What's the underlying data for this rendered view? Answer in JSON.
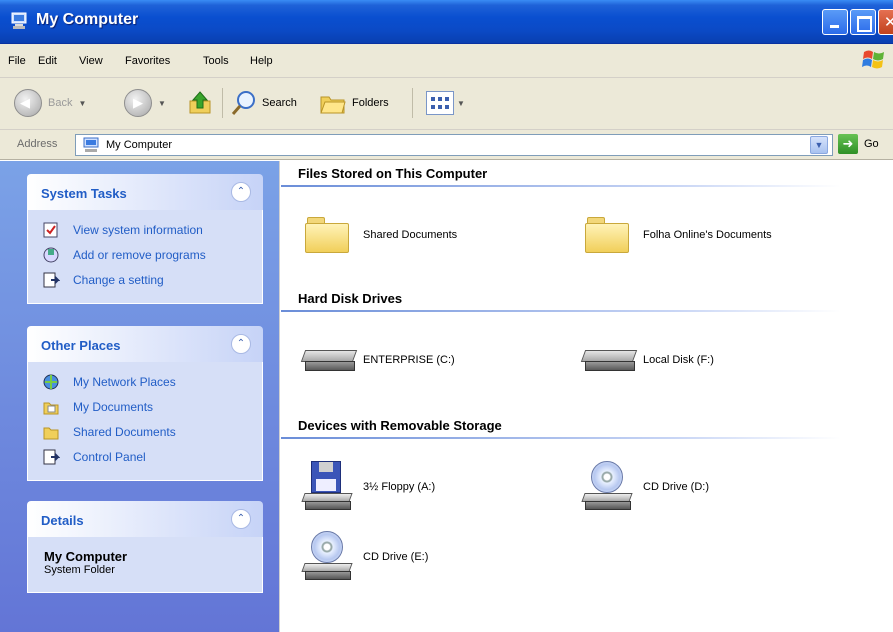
{
  "window": {
    "title": "My Computer"
  },
  "menu": [
    "File",
    "Edit",
    "View",
    "Favorites",
    "Tools",
    "Help"
  ],
  "toolbar": {
    "back_label": "Back",
    "search_label": "Search",
    "folders_label": "Folders"
  },
  "address": {
    "label": "Address",
    "value": "My Computer",
    "go_label": "Go"
  },
  "sidebar": {
    "system_tasks": {
      "title": "System Tasks",
      "items": [
        {
          "label": "View system information",
          "icon": "system-info-icon"
        },
        {
          "label": "Add or remove programs",
          "icon": "add-remove-programs-icon"
        },
        {
          "label": "Change a setting",
          "icon": "control-panel-icon"
        }
      ]
    },
    "other_places": {
      "title": "Other Places",
      "items": [
        {
          "label": "My Network Places",
          "icon": "network-places-icon"
        },
        {
          "label": "My Documents",
          "icon": "my-documents-icon"
        },
        {
          "label": "Shared Documents",
          "icon": "folder-icon"
        },
        {
          "label": "Control Panel",
          "icon": "control-panel-icon"
        }
      ]
    },
    "details": {
      "title": "Details",
      "name": "My Computer",
      "type": "System Folder"
    }
  },
  "content": {
    "groups": [
      {
        "title": "Files Stored on This Computer",
        "items": [
          {
            "label": "Shared Documents",
            "icon": "folder-icon"
          },
          {
            "label": "Folha Online's Documents",
            "icon": "folder-icon"
          }
        ]
      },
      {
        "title": "Hard Disk Drives",
        "items": [
          {
            "label": "ENTERPRISE (C:)",
            "icon": "hard-disk-icon"
          },
          {
            "label": "Local Disk (F:)",
            "icon": "hard-disk-icon"
          }
        ]
      },
      {
        "title": "Devices with Removable Storage",
        "items": [
          {
            "label": "3½ Floppy (A:)",
            "icon": "floppy-drive-icon"
          },
          {
            "label": "CD Drive (D:)",
            "icon": "cd-drive-icon"
          },
          {
            "label": "CD Drive (E:)",
            "icon": "cd-drive-icon"
          }
        ]
      }
    ]
  },
  "colors": {
    "title_bar": "#0a4fd0",
    "task_pane": "#7ba2e7",
    "link": "#215dc6",
    "chrome": "#ece9d8"
  }
}
